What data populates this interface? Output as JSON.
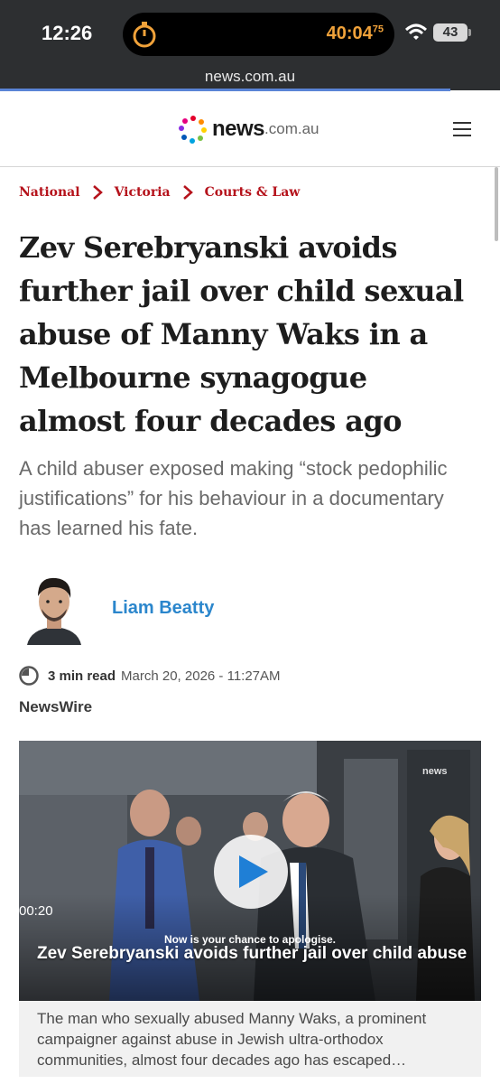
{
  "status_bar": {
    "time": "12:26",
    "timer": "40:04",
    "timer_fraction": "75",
    "battery": "43"
  },
  "browser": {
    "url": "news.com.au",
    "load_progress_fraction": 0.9
  },
  "site": {
    "logo_main": "news",
    "logo_suffix": ".com.au"
  },
  "breadcrumb": [
    "National",
    "Victoria",
    "Courts & Law"
  ],
  "article": {
    "headline": "Zev Serebryanski avoids further jail over child sexual abuse of Manny Waks in a Melbourne synagogue almost four decades ago",
    "standfirst": "A child abuser exposed making “stock pedophilic justifications” for his behaviour in a documentary has learned his fate.",
    "author": "Liam Beatty",
    "read_time": "3 min read",
    "date": "March 20, 2026 - 11:27AM",
    "source": "NewsWire"
  },
  "video": {
    "duration": "00:20",
    "caption_overlay": "Now is your chance to apologise.",
    "title": "Zev Serebryanski avoids further jail over child abuse",
    "logo": "news",
    "description": "The man who sexually abused Manny Waks, a prominent campaigner against abuse in Jewish ultra-orthodox communities, almost four decades ago has escaped…"
  },
  "colors": {
    "accent_red": "#b5121b",
    "author_blue": "#2b86cc",
    "timer_orange": "#f0a23a"
  },
  "icons": [
    "timer-icon",
    "wifi-icon",
    "battery-icon",
    "menu-icon",
    "chevron-right-icon",
    "clock-icon",
    "play-icon"
  ]
}
